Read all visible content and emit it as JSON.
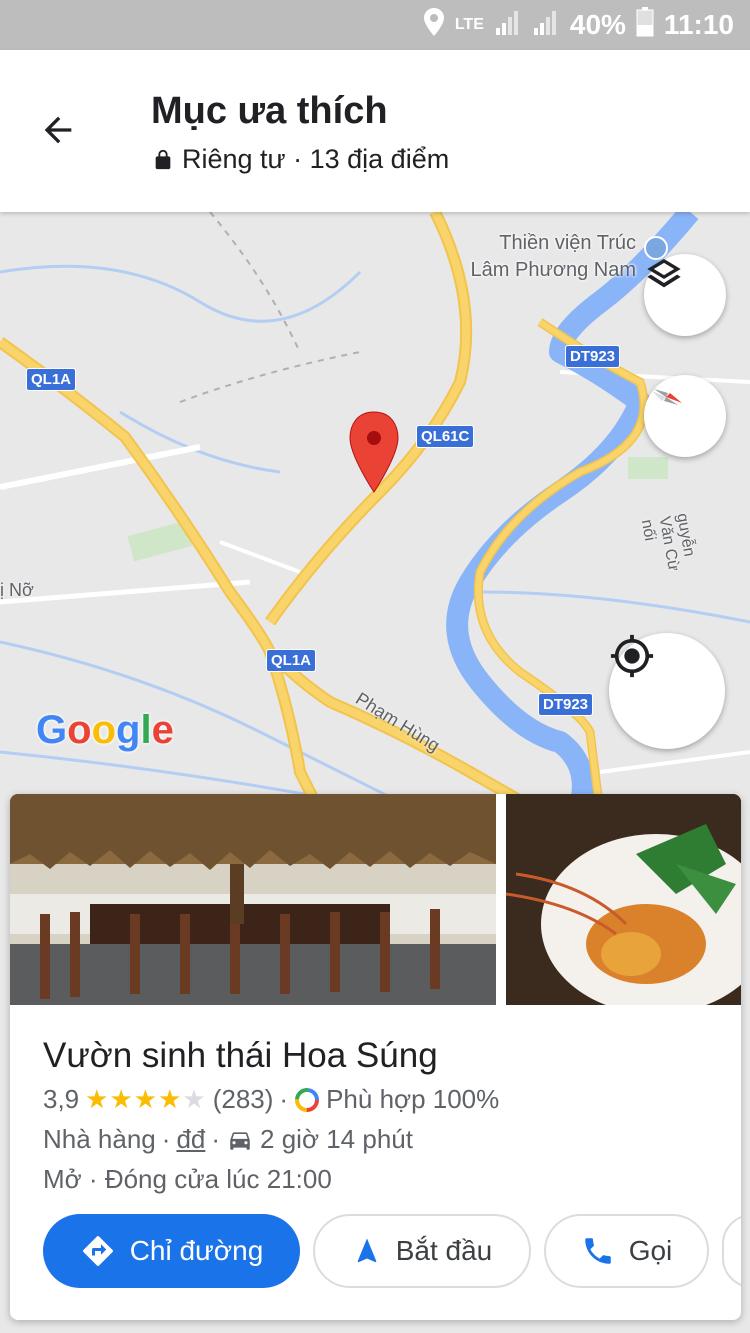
{
  "status_bar": {
    "network": "LTE",
    "battery": "40%",
    "time": "11:10"
  },
  "header": {
    "title": "Mục ưa thích",
    "subtitle": "Riêng tư · 13 địa điểm"
  },
  "map": {
    "place_labels": [
      "Thiền viện Trúc",
      "Lâm Phương Nam"
    ],
    "road_labels": [
      "QL1A",
      "QL61C",
      "DT923",
      "QL1A",
      "DT923"
    ],
    "street_labels": [
      "Phạm Hùng",
      "ị Nỡ",
      "guyễn Văn Cừ nối"
    ],
    "logo": "Google"
  },
  "card": {
    "name": "Vườn sinh thái Hoa Súng",
    "rating": "3,9",
    "stars_filled": 4,
    "reviews": "(283)",
    "match": "Phù hợp 100%",
    "category": "Nhà hàng",
    "price": "đđ",
    "drive_time": "2 giờ 14 phút",
    "hours": "Mở · Đóng cửa lúc 21:00",
    "buttons": {
      "directions": "Chỉ đường",
      "start": "Bắt đầu",
      "call": "Gọi"
    }
  },
  "colors": {
    "accent": "#1a73e8",
    "pin": "#ea4335",
    "road": "#f8d46a",
    "water": "#8ab4f8"
  }
}
